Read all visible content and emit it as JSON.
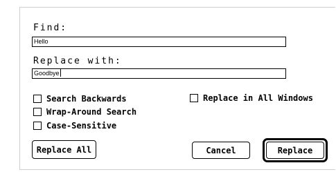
{
  "find": {
    "label": "Find:",
    "value": "Hello"
  },
  "replace": {
    "label": "Replace with:",
    "value": "Goodbye"
  },
  "options": {
    "search_backwards": {
      "label": "Search Backwards",
      "checked": false
    },
    "wrap_around": {
      "label": "Wrap-Around Search",
      "checked": false
    },
    "case_sensitive": {
      "label": "Case-Sensitive",
      "checked": false
    },
    "replace_all_windows": {
      "label": "Replace in All Windows",
      "checked": false
    }
  },
  "buttons": {
    "replace_all": "Replace All",
    "cancel": "Cancel",
    "replace": "Replace"
  }
}
